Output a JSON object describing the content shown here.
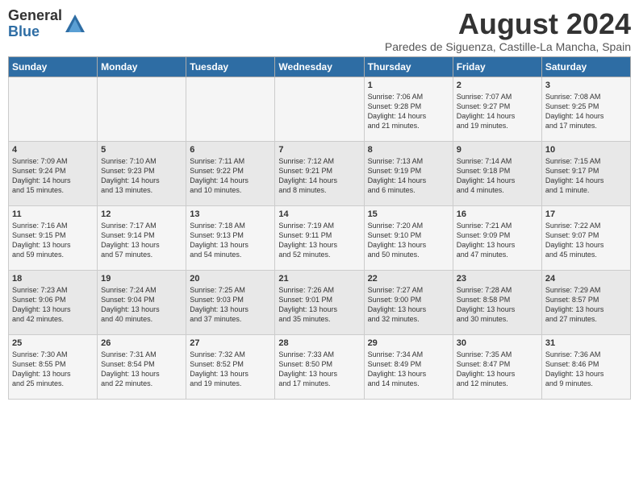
{
  "logo": {
    "general": "General",
    "blue": "Blue"
  },
  "title": "August 2024",
  "subtitle": "Paredes de Siguenza, Castille-La Mancha, Spain",
  "days_of_week": [
    "Sunday",
    "Monday",
    "Tuesday",
    "Wednesday",
    "Thursday",
    "Friday",
    "Saturday"
  ],
  "weeks": [
    [
      {
        "day": "",
        "content": ""
      },
      {
        "day": "",
        "content": ""
      },
      {
        "day": "",
        "content": ""
      },
      {
        "day": "",
        "content": ""
      },
      {
        "day": "1",
        "content": "Sunrise: 7:06 AM\nSunset: 9:28 PM\nDaylight: 14 hours\nand 21 minutes."
      },
      {
        "day": "2",
        "content": "Sunrise: 7:07 AM\nSunset: 9:27 PM\nDaylight: 14 hours\nand 19 minutes."
      },
      {
        "day": "3",
        "content": "Sunrise: 7:08 AM\nSunset: 9:25 PM\nDaylight: 14 hours\nand 17 minutes."
      }
    ],
    [
      {
        "day": "4",
        "content": "Sunrise: 7:09 AM\nSunset: 9:24 PM\nDaylight: 14 hours\nand 15 minutes."
      },
      {
        "day": "5",
        "content": "Sunrise: 7:10 AM\nSunset: 9:23 PM\nDaylight: 14 hours\nand 13 minutes."
      },
      {
        "day": "6",
        "content": "Sunrise: 7:11 AM\nSunset: 9:22 PM\nDaylight: 14 hours\nand 10 minutes."
      },
      {
        "day": "7",
        "content": "Sunrise: 7:12 AM\nSunset: 9:21 PM\nDaylight: 14 hours\nand 8 minutes."
      },
      {
        "day": "8",
        "content": "Sunrise: 7:13 AM\nSunset: 9:19 PM\nDaylight: 14 hours\nand 6 minutes."
      },
      {
        "day": "9",
        "content": "Sunrise: 7:14 AM\nSunset: 9:18 PM\nDaylight: 14 hours\nand 4 minutes."
      },
      {
        "day": "10",
        "content": "Sunrise: 7:15 AM\nSunset: 9:17 PM\nDaylight: 14 hours\nand 1 minute."
      }
    ],
    [
      {
        "day": "11",
        "content": "Sunrise: 7:16 AM\nSunset: 9:15 PM\nDaylight: 13 hours\nand 59 minutes."
      },
      {
        "day": "12",
        "content": "Sunrise: 7:17 AM\nSunset: 9:14 PM\nDaylight: 13 hours\nand 57 minutes."
      },
      {
        "day": "13",
        "content": "Sunrise: 7:18 AM\nSunset: 9:13 PM\nDaylight: 13 hours\nand 54 minutes."
      },
      {
        "day": "14",
        "content": "Sunrise: 7:19 AM\nSunset: 9:11 PM\nDaylight: 13 hours\nand 52 minutes."
      },
      {
        "day": "15",
        "content": "Sunrise: 7:20 AM\nSunset: 9:10 PM\nDaylight: 13 hours\nand 50 minutes."
      },
      {
        "day": "16",
        "content": "Sunrise: 7:21 AM\nSunset: 9:09 PM\nDaylight: 13 hours\nand 47 minutes."
      },
      {
        "day": "17",
        "content": "Sunrise: 7:22 AM\nSunset: 9:07 PM\nDaylight: 13 hours\nand 45 minutes."
      }
    ],
    [
      {
        "day": "18",
        "content": "Sunrise: 7:23 AM\nSunset: 9:06 PM\nDaylight: 13 hours\nand 42 minutes."
      },
      {
        "day": "19",
        "content": "Sunrise: 7:24 AM\nSunset: 9:04 PM\nDaylight: 13 hours\nand 40 minutes."
      },
      {
        "day": "20",
        "content": "Sunrise: 7:25 AM\nSunset: 9:03 PM\nDaylight: 13 hours\nand 37 minutes."
      },
      {
        "day": "21",
        "content": "Sunrise: 7:26 AM\nSunset: 9:01 PM\nDaylight: 13 hours\nand 35 minutes."
      },
      {
        "day": "22",
        "content": "Sunrise: 7:27 AM\nSunset: 9:00 PM\nDaylight: 13 hours\nand 32 minutes."
      },
      {
        "day": "23",
        "content": "Sunrise: 7:28 AM\nSunset: 8:58 PM\nDaylight: 13 hours\nand 30 minutes."
      },
      {
        "day": "24",
        "content": "Sunrise: 7:29 AM\nSunset: 8:57 PM\nDaylight: 13 hours\nand 27 minutes."
      }
    ],
    [
      {
        "day": "25",
        "content": "Sunrise: 7:30 AM\nSunset: 8:55 PM\nDaylight: 13 hours\nand 25 minutes."
      },
      {
        "day": "26",
        "content": "Sunrise: 7:31 AM\nSunset: 8:54 PM\nDaylight: 13 hours\nand 22 minutes."
      },
      {
        "day": "27",
        "content": "Sunrise: 7:32 AM\nSunset: 8:52 PM\nDaylight: 13 hours\nand 19 minutes."
      },
      {
        "day": "28",
        "content": "Sunrise: 7:33 AM\nSunset: 8:50 PM\nDaylight: 13 hours\nand 17 minutes."
      },
      {
        "day": "29",
        "content": "Sunrise: 7:34 AM\nSunset: 8:49 PM\nDaylight: 13 hours\nand 14 minutes."
      },
      {
        "day": "30",
        "content": "Sunrise: 7:35 AM\nSunset: 8:47 PM\nDaylight: 13 hours\nand 12 minutes."
      },
      {
        "day": "31",
        "content": "Sunrise: 7:36 AM\nSunset: 8:46 PM\nDaylight: 13 hours\nand 9 minutes."
      }
    ]
  ]
}
